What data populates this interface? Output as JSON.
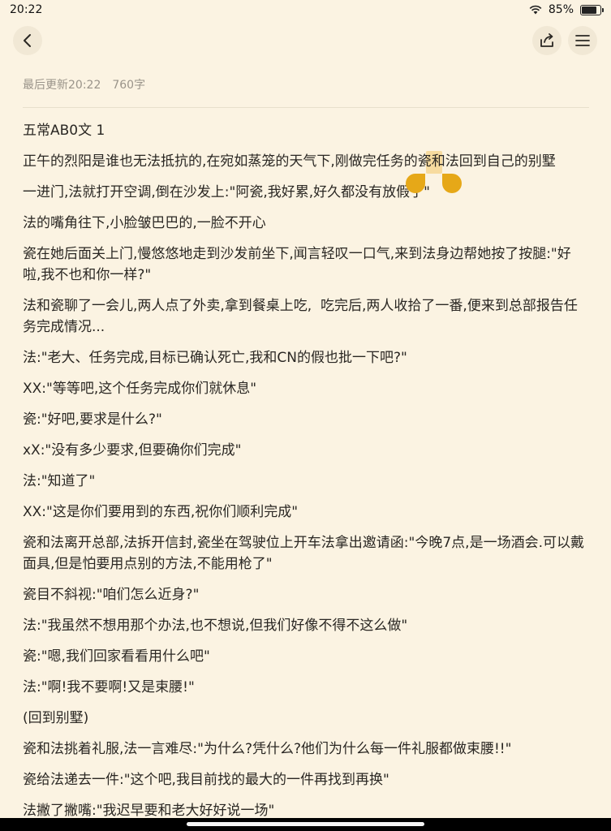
{
  "status": {
    "time": "20:22",
    "battery": "85%",
    "battery_level": 0.85
  },
  "meta": {
    "last_updated": "最后更新20:22",
    "word_count": "760字"
  },
  "icons": {
    "back": "back-chevron-icon",
    "share": "share-icon",
    "menu": "menu-icon"
  },
  "chapter": {
    "title": "五常AB0文  1",
    "paragraphs": [
      "正午的烈阳是谁也无法抵抗的,在宛如蒸笼的天气下,刚做完任务的瓷和法回到自己的别墅",
      "一进门,法就打开空调,倒在沙发上:\"阿瓷,我好累,好久都没有放假了\"",
      "法的嘴角往下,小脸皱巴巴的,一脸不开心",
      "瓷在她后面关上门,慢悠悠地走到沙发前坐下,闻言轻叹一口气,来到法身边帮她按了按腿:\"好啦,我不也和你一样?\"",
      "法和瓷聊了一会儿,两人点了外卖,拿到餐桌上吃,  吃完后,两人收拾了一番,便来到总部报告任务完成情况...",
      "法:\"老大、任务完成,目标已确认死亡,我和CN的假也批一下吧?\"",
      "XX:\"等等吧,这个任务完成你们就休息\"",
      "瓷:\"好吧,要求是什么?\"",
      "xX:\"没有多少要求,但要确你们完成\"",
      "法:\"知道了\"",
      "XX:\"这是你们要用到的东西,祝你们顺利完成\"",
      "瓷和法离开总部,法拆开信封,瓷坐在驾驶位上开车法拿出邀请函:\"今晚7点,是一场酒会.可以戴面具,但是怕要用点别的方法,不能用枪了\"",
      "瓷目不斜视:\"咱们怎么近身?\"",
      "法:\"我虽然不想用那个办法,也不想说,但我们好像不得不这么做\"",
      "瓷:\"嗯,我们回家看看用什么吧\"",
      "法:\"啊!我不要啊!又是束腰!\"",
      "(回到别墅)",
      "瓷和法挑着礼服,法一言难尽:\"为什么?凭什么?他们为什么每一件礼服都做束腰!!\"",
      "瓷给法递去一件:\"这个吧,我目前找的最大的一件再找到再换\"",
      "法撇了撇嘴:\"我迟早要和老大好好说一场\""
    ]
  }
}
